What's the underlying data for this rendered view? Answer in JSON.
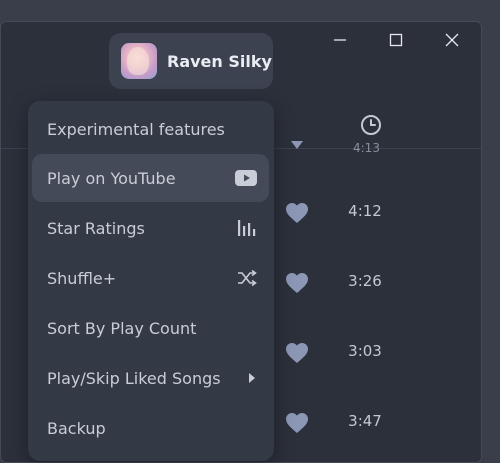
{
  "profile": {
    "name": "Raven Silky"
  },
  "menu": {
    "items": [
      {
        "label": "Experimental features"
      },
      {
        "label": "Play on YouTube",
        "icon": "youtube-icon"
      },
      {
        "label": "Star Ratings",
        "icon": "bar-chart-icon"
      },
      {
        "label": "Shuffle+",
        "icon": "shuffle-icon"
      },
      {
        "label": "Sort By Play Count"
      },
      {
        "label": "Play/Skip Liked Songs",
        "icon": "chevron-right-icon"
      },
      {
        "label": "Backup"
      }
    ]
  },
  "tracks": {
    "header_icon": "clock-icon",
    "partial_duration": "4:13",
    "rows": [
      {
        "duration": "4:12",
        "liked": true
      },
      {
        "duration": "3:26",
        "liked": true
      },
      {
        "duration": "3:03",
        "liked": true
      },
      {
        "duration": "3:47",
        "liked": true
      }
    ]
  },
  "window_controls": [
    "minimize-icon",
    "maximize-icon",
    "close-icon"
  ],
  "colors": {
    "background": "#2c303b",
    "menu": "#343946",
    "accent_icon": "#9aa6c2"
  }
}
